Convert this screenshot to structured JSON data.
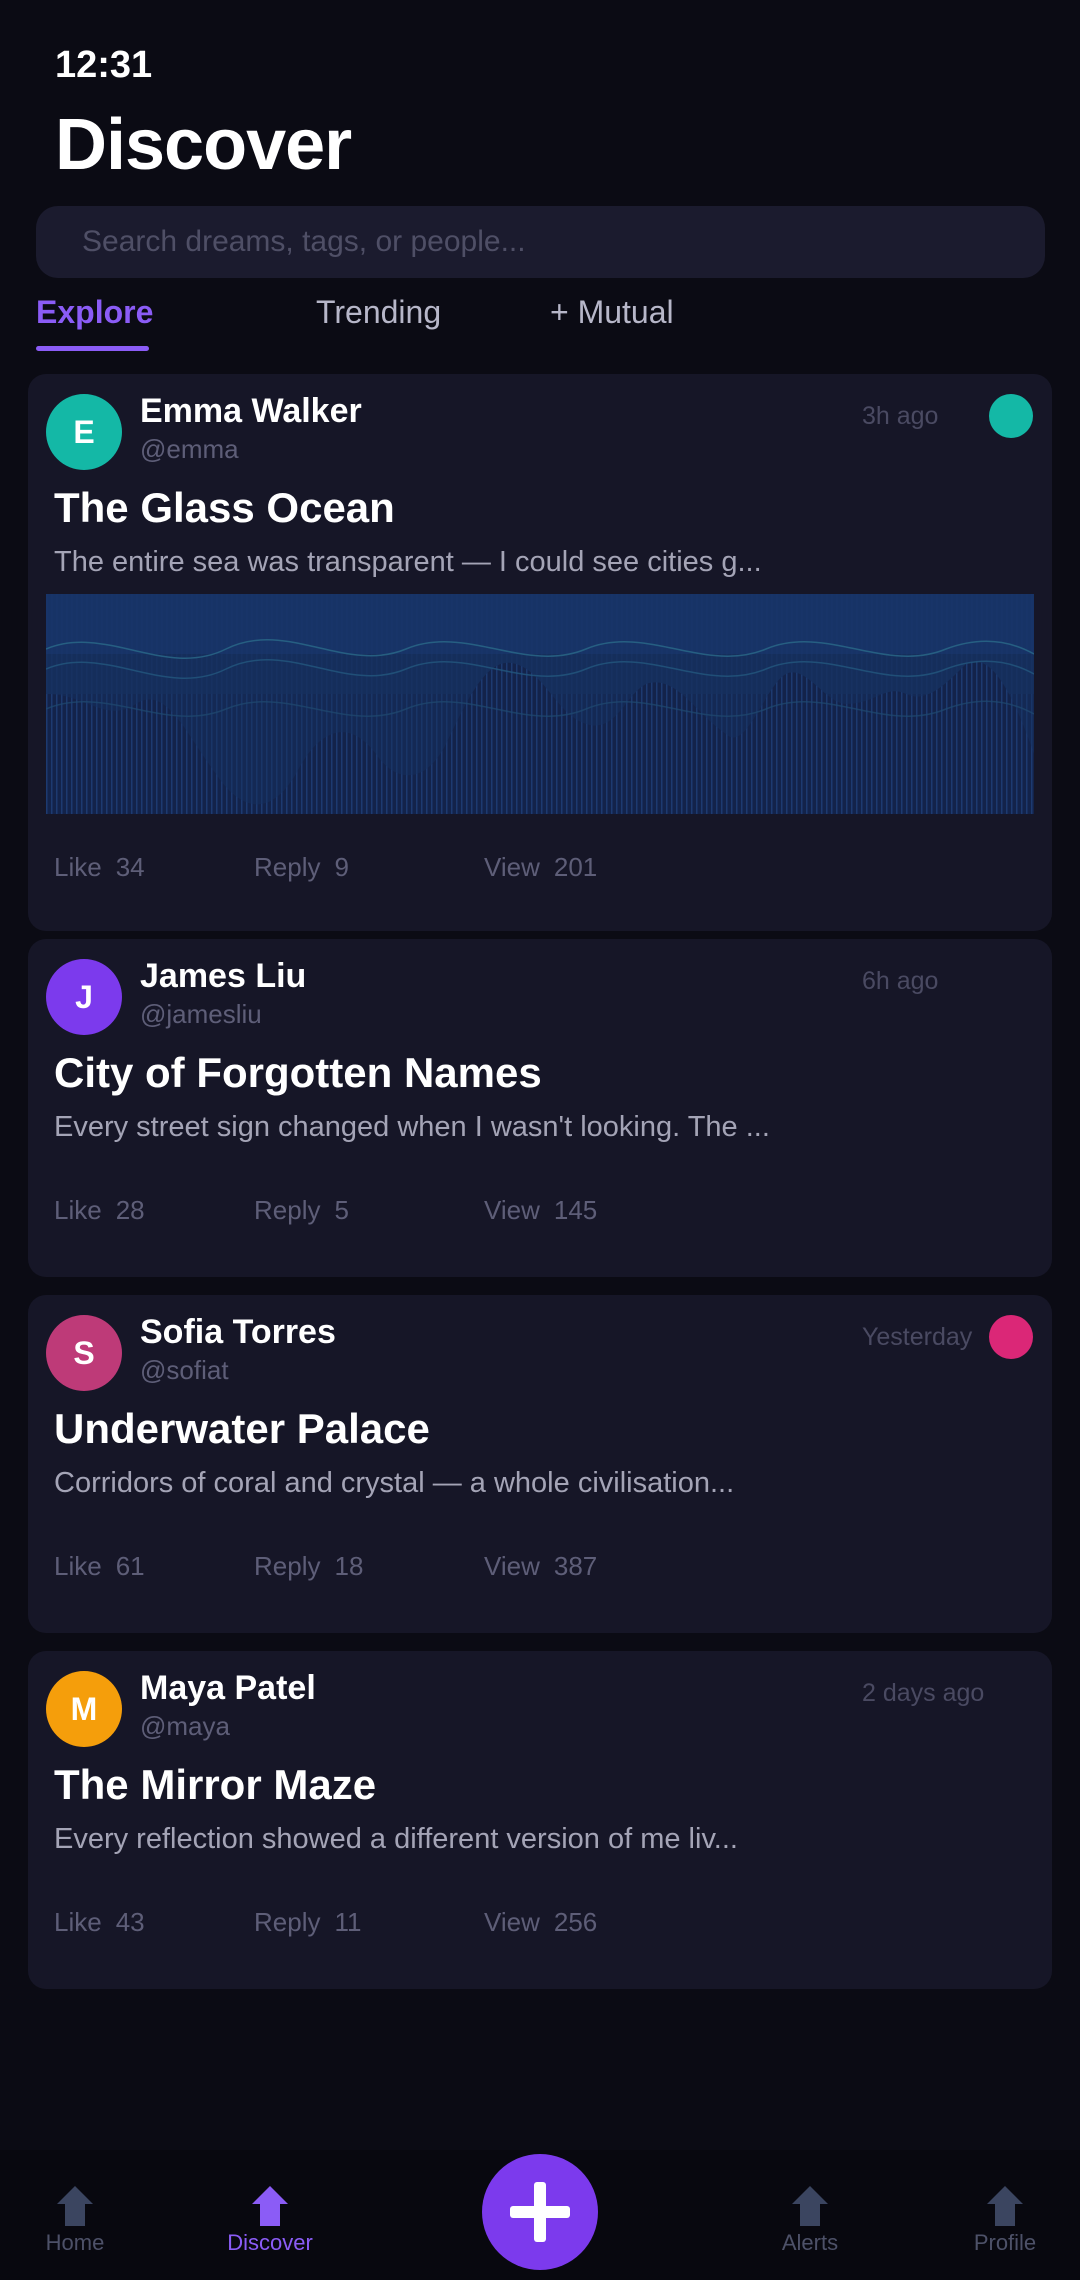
{
  "status": {
    "time": "12:31"
  },
  "page": {
    "title": "Discover"
  },
  "search": {
    "placeholder": "Search dreams, tags, or people...",
    "value": ""
  },
  "tabs": [
    {
      "label": "Explore",
      "active": true
    },
    {
      "label": "Trending",
      "active": false
    },
    {
      "label": "+ Mutual",
      "active": false
    }
  ],
  "posts": [
    {
      "avatar_initial": "E",
      "avatar_color": "#14b8a6",
      "author": "Emma Walker",
      "handle": "@emma",
      "time": "3h ago",
      "mood_color": "#14b8a6",
      "title": "The Glass Ocean",
      "excerpt": "The entire sea was transparent — I could see cities g...",
      "has_waveform": true,
      "stats": {
        "like_label": "Like",
        "like": "34",
        "reply_label": "Reply",
        "reply": "9",
        "view_label": "View",
        "view": "201"
      }
    },
    {
      "avatar_initial": "J",
      "avatar_color": "#7c3aed",
      "author": "James Liu",
      "handle": "@jamesliu",
      "time": "6h ago",
      "title": "City of Forgotten Names",
      "excerpt": "Every street sign changed when I wasn't looking. The ...",
      "stats": {
        "like_label": "Like",
        "like": "28",
        "reply_label": "Reply",
        "reply": "5",
        "view_label": "View",
        "view": "145"
      }
    },
    {
      "avatar_initial": "S",
      "avatar_color": "#be3a78",
      "author": "Sofia Torres",
      "handle": "@sofiat",
      "time": "Yesterday",
      "mood_color": "#db2777",
      "title": "Underwater Palace",
      "excerpt": "Corridors of coral and crystal — a whole civilisation...",
      "stats": {
        "like_label": "Like",
        "like": "61",
        "reply_label": "Reply",
        "reply": "18",
        "view_label": "View",
        "view": "387"
      }
    },
    {
      "avatar_initial": "M",
      "avatar_color": "#f59e0b",
      "author": "Maya Patel",
      "handle": "@maya",
      "time": "2 days ago",
      "title": "The Mirror Maze",
      "excerpt": "Every reflection showed a different version of me liv...",
      "stats": {
        "like_label": "Like",
        "like": "43",
        "reply_label": "Reply",
        "reply": "11",
        "view_label": "View",
        "view": "256"
      }
    }
  ],
  "nav": [
    {
      "label": "Home",
      "icon": "home-icon",
      "active": false
    },
    {
      "label": "Discover",
      "icon": "discover-icon",
      "active": true
    },
    {
      "label": "Alerts",
      "icon": "alerts-icon",
      "active": false
    },
    {
      "label": "Profile",
      "icon": "profile-icon",
      "active": false
    }
  ],
  "fab": {
    "icon": "plus-icon"
  },
  "colors": {
    "accent": "#8b5cf6",
    "background": "#0b0b14",
    "card": "#161627"
  }
}
